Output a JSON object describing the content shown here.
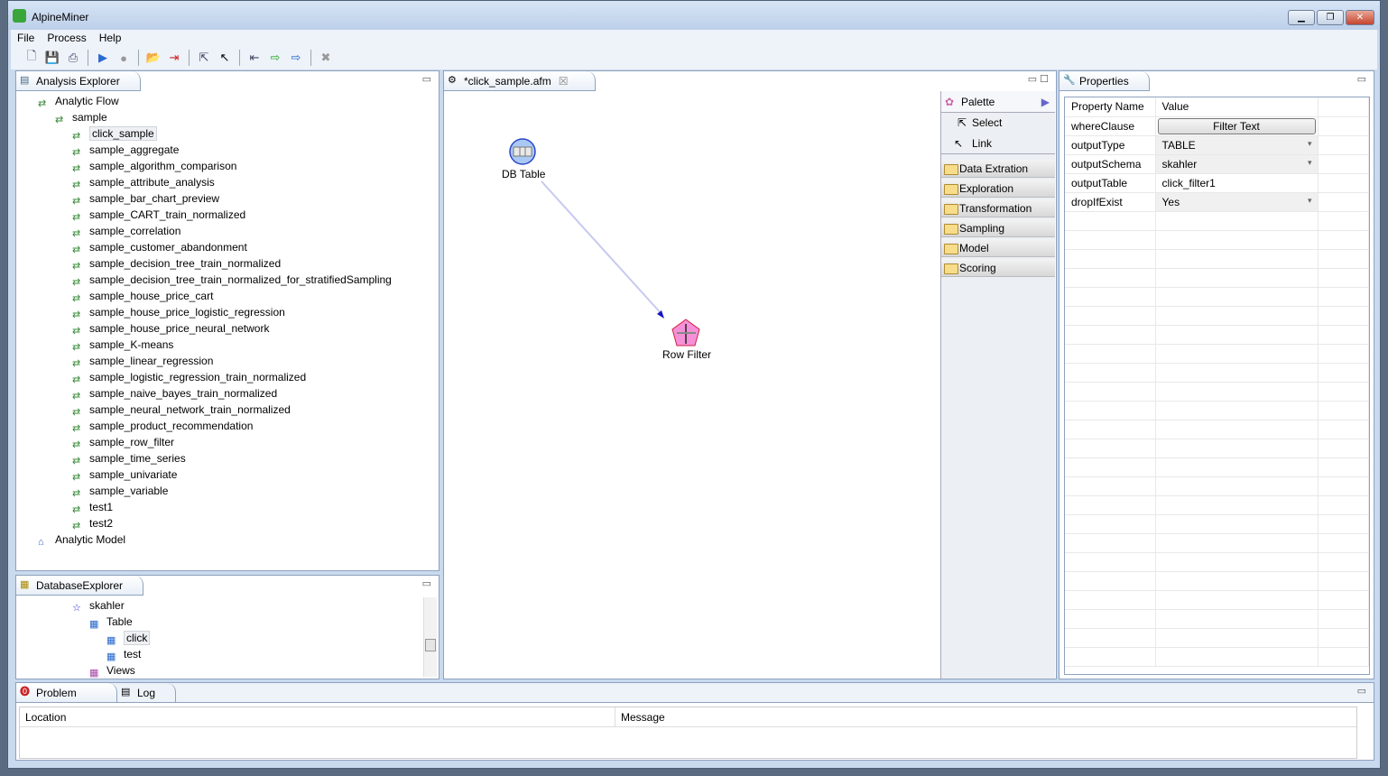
{
  "app": {
    "title": "AlpineMiner"
  },
  "menu": [
    "File",
    "Process",
    "Help"
  ],
  "toolbar": [
    "new-icon",
    "save-icon",
    "print-icon",
    "run-icon",
    "stop-icon",
    "open-folder-icon",
    "exit-icon",
    "select-icon",
    "link-arrow-icon",
    "import-icon",
    "export-green-icon",
    "export-blue-icon",
    "delete-icon"
  ],
  "analysis_explorer": {
    "title": "Analysis Explorer",
    "flow": "Analytic Flow",
    "folder": "sample",
    "items": [
      "click_sample",
      "sample_aggregate",
      "sample_algorithm_comparison",
      "sample_attribute_analysis",
      "sample_bar_chart_preview",
      "sample_CART_train_normalized",
      "sample_correlation",
      "sample_customer_abandonment",
      "sample_decision_tree_train_normalized",
      "sample_decision_tree_train_normalized_for_stratifiedSampling",
      "sample_house_price_cart",
      "sample_house_price_logistic_regression",
      "sample_house_price_neural_network",
      "sample_K-means",
      "sample_linear_regression",
      "sample_logistic_regression_train_normalized",
      "sample_naive_bayes_train_normalized",
      "sample_neural_network_train_normalized",
      "sample_product_recommendation",
      "sample_row_filter",
      "sample_time_series",
      "sample_univariate",
      "sample_variable",
      "test1",
      "test2"
    ],
    "selected": "click_sample",
    "model": "Analytic Model"
  },
  "database_explorer": {
    "title": "DatabaseExplorer",
    "schema": "skahler",
    "table_folder": "Table",
    "tables": [
      "click",
      "test"
    ],
    "views": "Views"
  },
  "editor": {
    "tab": "*click_sample.afm",
    "nodes": [
      {
        "label": "DB Table"
      },
      {
        "label": "Row Filter"
      }
    ]
  },
  "palette": {
    "title": "Palette",
    "tools": [
      "Select",
      "Link"
    ],
    "drawers": [
      "Data Extration",
      "Exploration",
      "Transformation",
      "Sampling",
      "Model",
      "Scoring"
    ]
  },
  "properties": {
    "title": "Properties",
    "headers": [
      "Property Name",
      "Value"
    ],
    "rows": [
      {
        "name": "whereClause",
        "value": "Filter Text",
        "kind": "button"
      },
      {
        "name": "outputType",
        "value": "TABLE",
        "kind": "dropdown"
      },
      {
        "name": "outputSchema",
        "value": "skahler",
        "kind": "dropdown"
      },
      {
        "name": "outputTable",
        "value": "click_filter1",
        "kind": "text"
      },
      {
        "name": "dropIfExist",
        "value": "Yes",
        "kind": "dropdown"
      }
    ]
  },
  "bottom": {
    "tabs": [
      "Problem",
      "Log"
    ],
    "headers": [
      "Location",
      "Message"
    ]
  }
}
